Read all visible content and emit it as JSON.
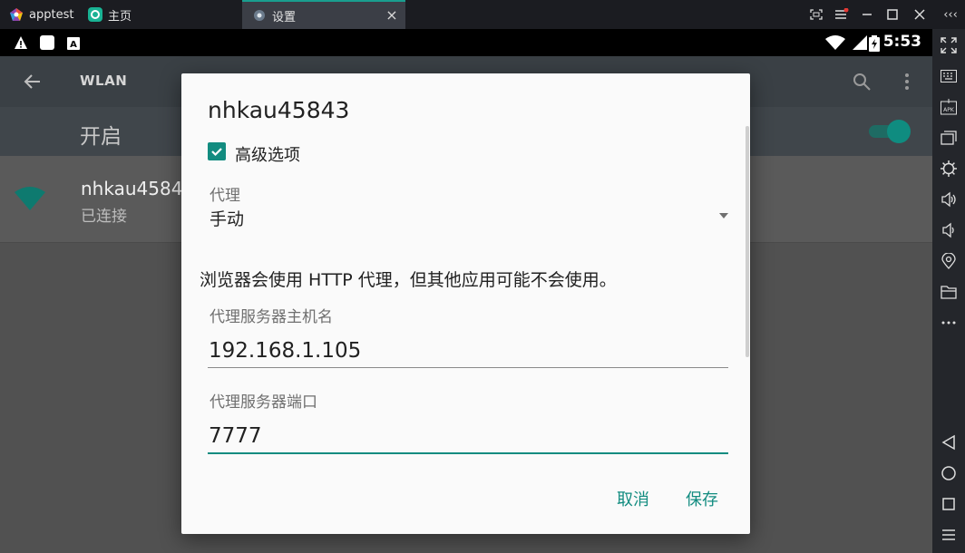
{
  "window": {
    "tabs": [
      {
        "label": "apptest",
        "icon": "apptest-logo-icon"
      },
      {
        "label": "主页",
        "icon": "home-app-icon"
      },
      {
        "label": "设置",
        "icon": "settings-gear-icon",
        "active": true
      }
    ],
    "collapse_label": "‹‹‹"
  },
  "statusbar": {
    "time": "5:53"
  },
  "app": {
    "title": "WLAN",
    "switch_label": "开启",
    "switch_on": true,
    "network": {
      "name": "nhkau45843",
      "status": "已连接"
    }
  },
  "dialog": {
    "title": "nhkau45843",
    "advanced_label": "高级选项",
    "advanced_checked": true,
    "proxy_caption": "代理",
    "proxy_value": "手动",
    "notice": "浏览器会使用 HTTP 代理，但其他应用可能不会使用。",
    "host_caption": "代理服务器主机名",
    "host_value": "192.168.1.105",
    "port_caption": "代理服务器端口",
    "port_value": "7777",
    "cancel_label": "取消",
    "save_label": "保存"
  },
  "colors": {
    "accent": "#128c80",
    "dialog_bg": "#fafafa",
    "appbar": "#3a4045"
  }
}
